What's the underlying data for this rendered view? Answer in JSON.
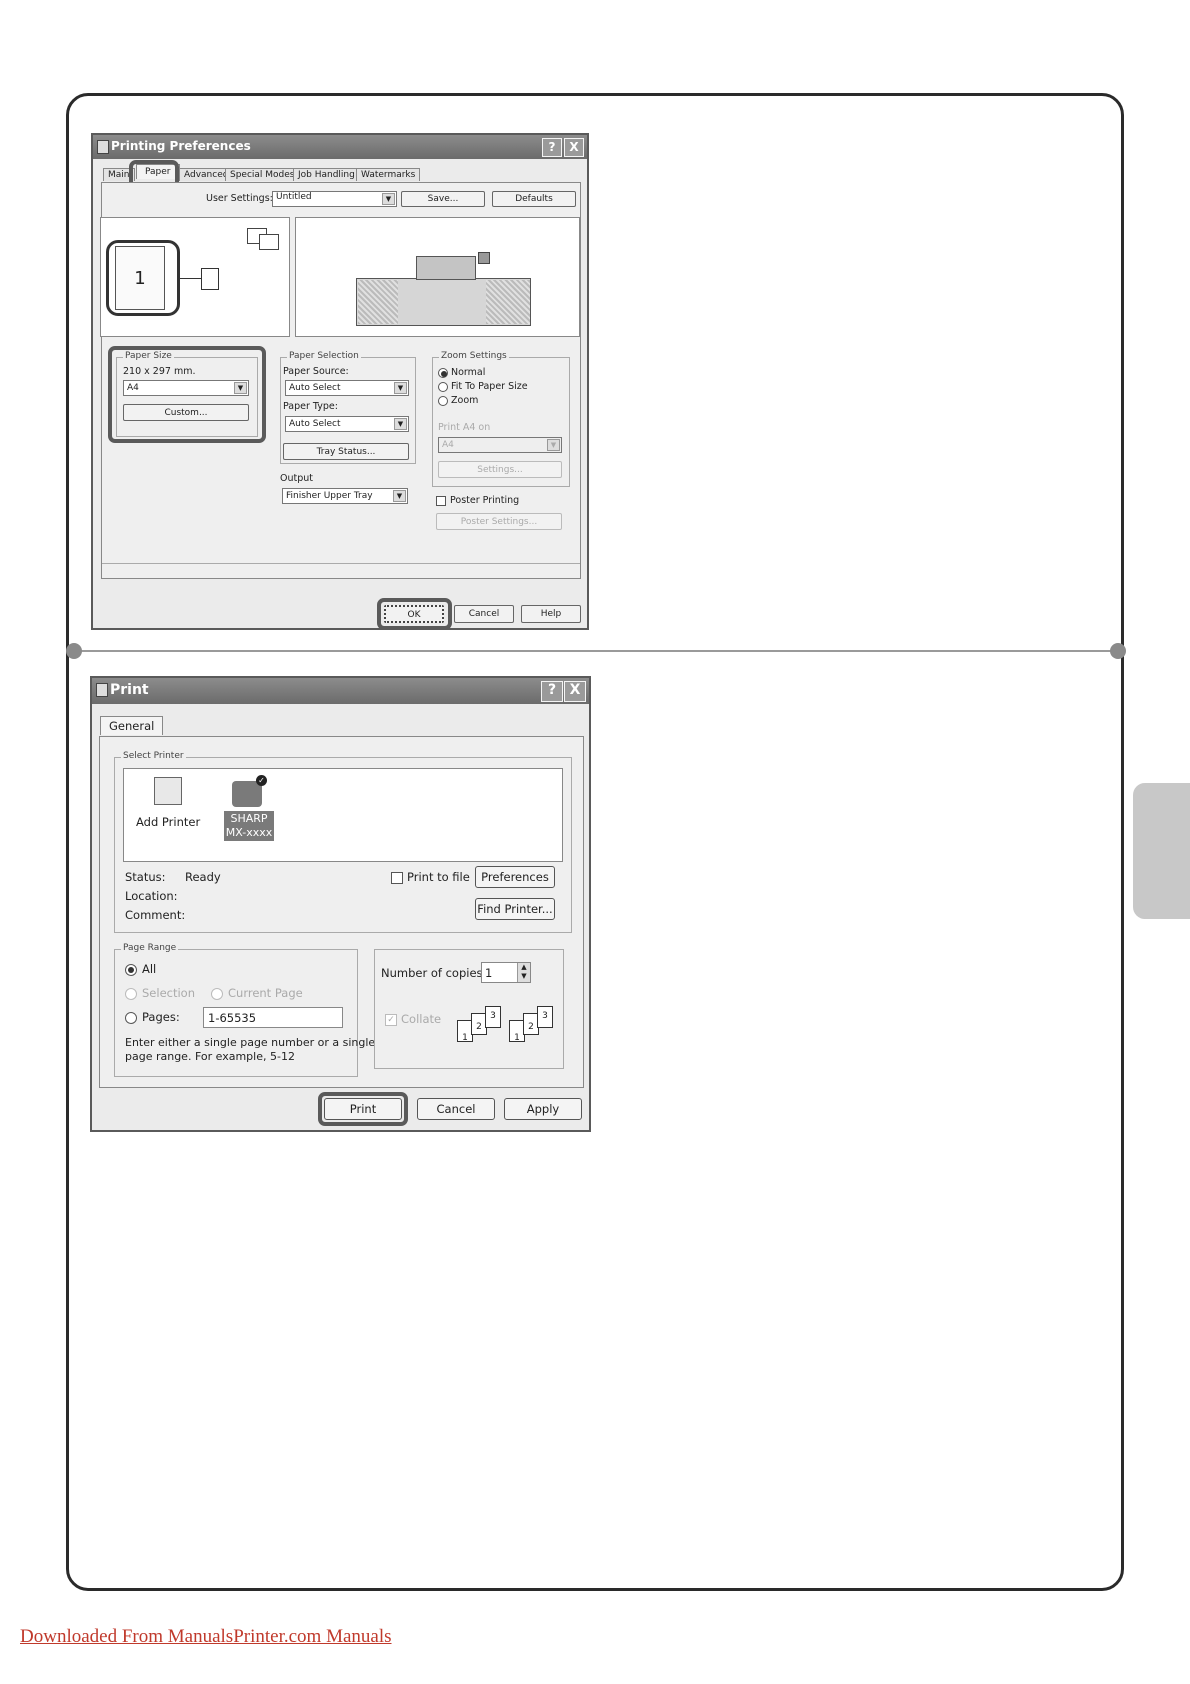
{
  "prefs": {
    "title": "Printing Preferences",
    "help_btn": "?",
    "close_btn": "X",
    "tabs": [
      "Main",
      "Paper",
      "Advanced",
      "Special Modes",
      "Job Handling",
      "Watermarks"
    ],
    "user_settings_label": "User Settings:",
    "user_settings_value": "Untitled",
    "save_label": "Save...",
    "defaults_label": "Defaults",
    "page_preview_number": "1",
    "paper_size": {
      "legend": "Paper Size",
      "dims": "210 x 297 mm.",
      "value": "A4",
      "custom_label": "Custom..."
    },
    "paper_selection": {
      "legend": "Paper Selection",
      "source_label": "Paper Source:",
      "source_value": "Auto Select",
      "type_label": "Paper Type:",
      "type_value": "Auto Select",
      "tray_status_label": "Tray Status..."
    },
    "output": {
      "label": "Output",
      "value": "Finisher Upper Tray"
    },
    "zoom": {
      "legend": "Zoom Settings",
      "normal": "Normal",
      "fit": "Fit To Paper Size",
      "zoom": "Zoom",
      "print_on_label": "Print A4 on",
      "print_on_value": "A4",
      "settings_label": "Settings..."
    },
    "poster": {
      "label": "Poster Printing",
      "settings_label": "Poster Settings..."
    },
    "ok_label": "OK",
    "cancel_label": "Cancel",
    "help_label": "Help"
  },
  "print": {
    "title": "Print",
    "help_btn": "?",
    "close_btn": "X",
    "tab_general": "General",
    "select_printer_legend": "Select Printer",
    "add_printer_label": "Add Printer",
    "printer_name_line1": "SHARP",
    "printer_name_line2": "MX-xxxx",
    "status_label": "Status:",
    "status_value": "Ready",
    "location_label": "Location:",
    "comment_label": "Comment:",
    "print_to_file_label": "Print to file",
    "preferences_label": "Preferences",
    "find_printer_label": "Find Printer...",
    "page_range_legend": "Page Range",
    "all_label": "All",
    "selection_label": "Selection",
    "current_page_label": "Current Page",
    "pages_label": "Pages:",
    "pages_value": "1-65535",
    "hint_line1": "Enter either a single page number or a single",
    "hint_line2": "page range.  For example, 5-12",
    "copies_label": "Number of copies:",
    "copies_value": "1",
    "collate_label": "Collate",
    "collate_nums": [
      "1",
      "2",
      "3"
    ],
    "print_label": "Print",
    "cancel_label": "Cancel",
    "apply_label": "Apply"
  },
  "footer": {
    "link_text": "Downloaded From ManualsPrinter.com Manuals"
  }
}
